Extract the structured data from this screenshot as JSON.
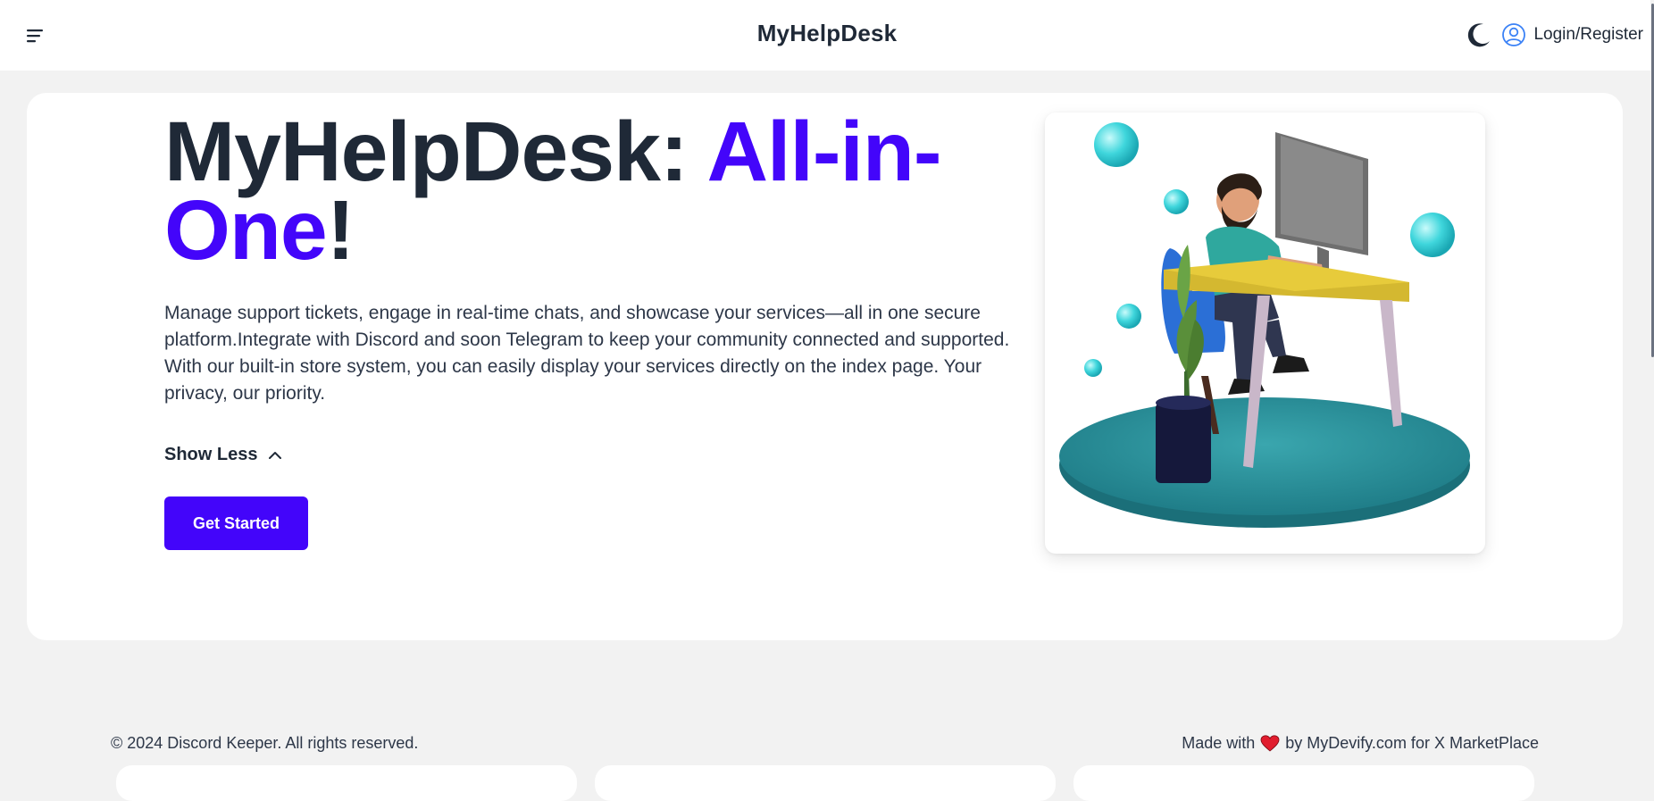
{
  "header": {
    "brand": "MyHelpDesk",
    "login_label": "Login/Register",
    "icons": {
      "menu": "menu-icon",
      "theme": "moon-icon",
      "user": "user-circle-icon"
    }
  },
  "hero": {
    "title_part1": "MyHelpDesk: ",
    "title_accent": "All-in-One",
    "title_end": "!",
    "description": "Manage support tickets, engage in real-time chats, and showcase your services—all in one secure platform.Integrate with Discord and soon Telegram to keep your community connected and supported. With our built-in store system, you can easily display your services directly on the index page. Your privacy, our priority.",
    "toggle_label": "Show Less",
    "cta_label": "Get Started",
    "accent_color": "#4305fa"
  },
  "footer": {
    "copyright": "© 2024 Discord Keeper. All rights reserved.",
    "made_prefix": "Made with",
    "made_suffix": "by MyDevify.com for X MarketPlace"
  }
}
